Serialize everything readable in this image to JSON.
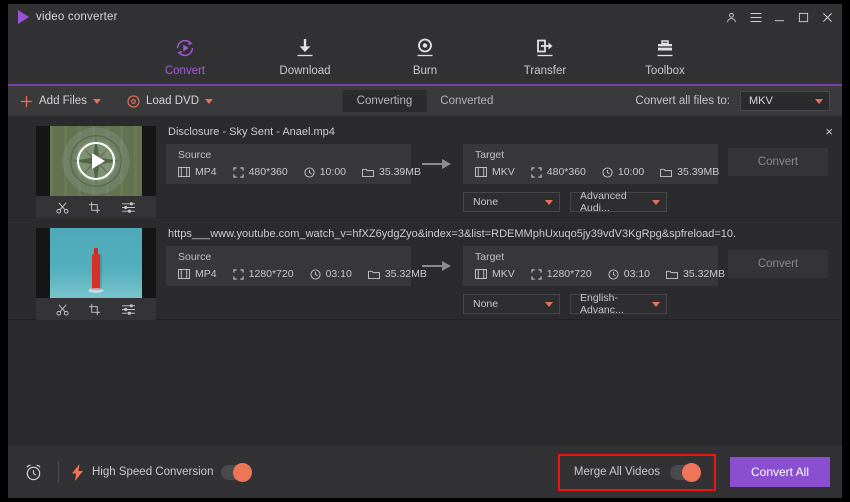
{
  "window": {
    "brand": "video converter",
    "controls": [
      {
        "name": "account-icon",
        "glyph": "account"
      },
      {
        "name": "menu-icon",
        "glyph": "menu"
      },
      {
        "name": "minimize-button",
        "glyph": "minimize"
      },
      {
        "name": "maximize-button",
        "glyph": "maximize"
      },
      {
        "name": "close-button",
        "glyph": "close"
      }
    ]
  },
  "nav": {
    "items": [
      {
        "label": "Convert",
        "icon": "convert-icon",
        "active": true
      },
      {
        "label": "Download",
        "icon": "download-icon",
        "active": false
      },
      {
        "label": "Burn",
        "icon": "burn-icon",
        "active": false
      },
      {
        "label": "Transfer",
        "icon": "transfer-icon",
        "active": false
      },
      {
        "label": "Toolbox",
        "icon": "toolbox-icon",
        "active": false
      }
    ],
    "accent_color": "#a25cd8",
    "underline_color": "#7b3fa8"
  },
  "toolbar": {
    "add_files_label": "Add Files",
    "load_dvd_label": "Load DVD",
    "tab_converting": "Converting",
    "tab_converted": "Converted",
    "active_tab": "Converting",
    "convert_all_files_to_label": "Convert all files to:",
    "format_value": "MKV",
    "accent_color": "#e8705a"
  },
  "list": {
    "close_label": "×",
    "rows": [
      {
        "title": "Disclosure - Sky Sent - Anael.mp4",
        "thumb": "green-crop-circle",
        "tools": [
          "trim-icon",
          "crop-icon",
          "effect-icon"
        ],
        "source": {
          "label": "Source",
          "format": "MP4",
          "resolution": "480*360",
          "duration": "10:00",
          "size": "35.39MB"
        },
        "target": {
          "label": "Target",
          "format": "MKV",
          "resolution": "480*360",
          "duration": "10:00",
          "size": "35.39MB"
        },
        "subtitle_select": "None",
        "audio_select": "Advanced Audi...",
        "convert_label": "Convert"
      },
      {
        "title": "https___www.youtube.com_watch_v=hfXZ6ydgZyo&index=3&list=RDEMMphUxuqo5jy39vdV3KgRpg&spfreload=10.",
        "thumb": "teal-bottle",
        "tools": [
          "trim-icon",
          "crop-icon",
          "effect-icon"
        ],
        "source": {
          "label": "Source",
          "format": "MP4",
          "resolution": "1280*720",
          "duration": "03:10",
          "size": "35.32MB"
        },
        "target": {
          "label": "Target",
          "format": "MKV",
          "resolution": "1280*720",
          "duration": "03:10",
          "size": "35.32MB"
        },
        "subtitle_select": "None",
        "audio_select": "English-Advanc...",
        "convert_label": "Convert"
      }
    ]
  },
  "bottom": {
    "alarm_icon": "alarm-icon",
    "high_speed_label": "High Speed Conversion",
    "high_speed_on": true,
    "merge_label": "Merge All Videos",
    "merge_on": true,
    "merge_highlight_color": "#f0150f",
    "convert_all_label": "Convert All",
    "convert_all_color": "#8a4fd1",
    "toggle_knob_color": "#ef7559"
  }
}
